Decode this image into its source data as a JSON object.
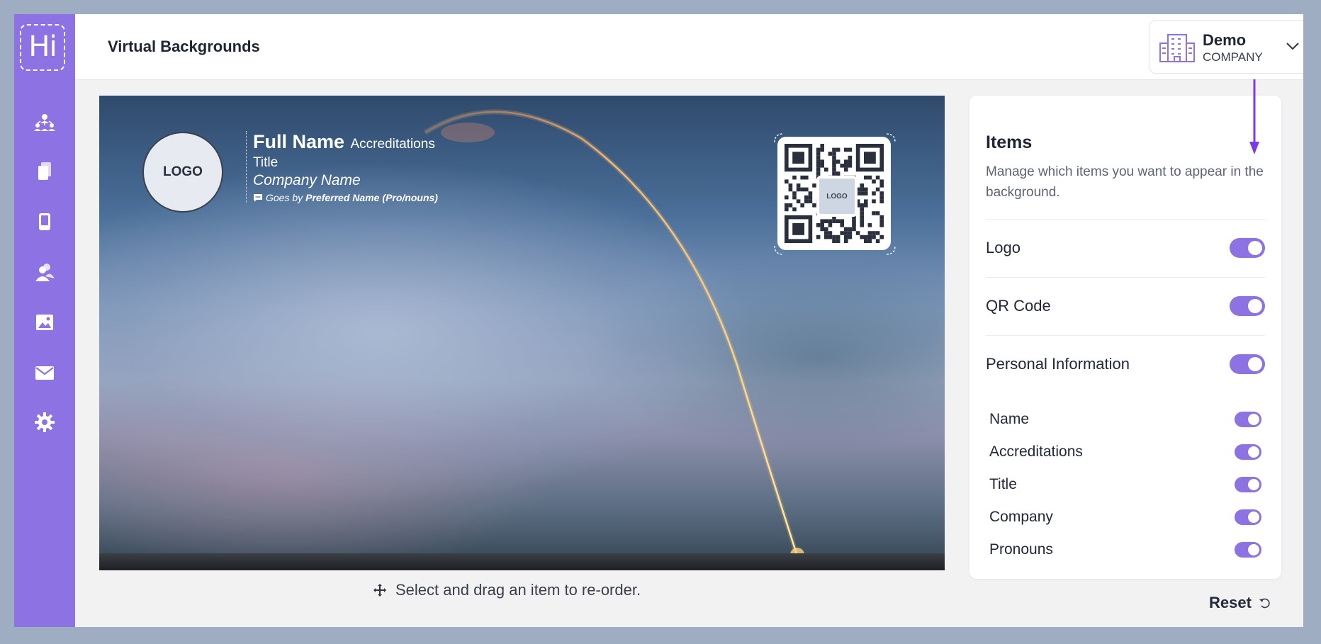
{
  "app": {
    "logo_text": "Hi"
  },
  "sidebar": {
    "items": [
      {
        "icon": "org-chart-icon"
      },
      {
        "icon": "cards-icon"
      },
      {
        "icon": "tablet-icon"
      },
      {
        "icon": "people-icon"
      },
      {
        "icon": "image-icon"
      },
      {
        "icon": "mail-icon"
      },
      {
        "icon": "gear-icon"
      }
    ]
  },
  "header": {
    "title": "Virtual Backgrounds",
    "company": {
      "name": "Demo",
      "subtitle": "COMPANY"
    }
  },
  "preview": {
    "logo_label": "LOGO",
    "full_name": "Full Name",
    "accreditations": "Accreditations",
    "title": "Title",
    "company_name": "Company Name",
    "pronouns_prefix": "Goes by",
    "preferred_name": "Preferred Name",
    "pronouns": "(Pro/nouns)",
    "qr_logo_label": "LOGO"
  },
  "drag_hint": "Select and drag an item to re-order.",
  "items_panel": {
    "title": "Items",
    "description": "Manage which items you want to appear in the background.",
    "items": [
      {
        "label": "Logo",
        "enabled": true
      },
      {
        "label": "QR Code",
        "enabled": true
      },
      {
        "label": "Personal Information",
        "enabled": true
      }
    ],
    "sub_items": [
      {
        "label": "Name",
        "enabled": true
      },
      {
        "label": "Accreditations",
        "enabled": true
      },
      {
        "label": "Title",
        "enabled": true
      },
      {
        "label": "Company",
        "enabled": true
      },
      {
        "label": "Pronouns",
        "enabled": true
      }
    ]
  },
  "reset_label": "Reset",
  "colors": {
    "accent": "#8d72e3",
    "annotation": "#7c3aed"
  }
}
